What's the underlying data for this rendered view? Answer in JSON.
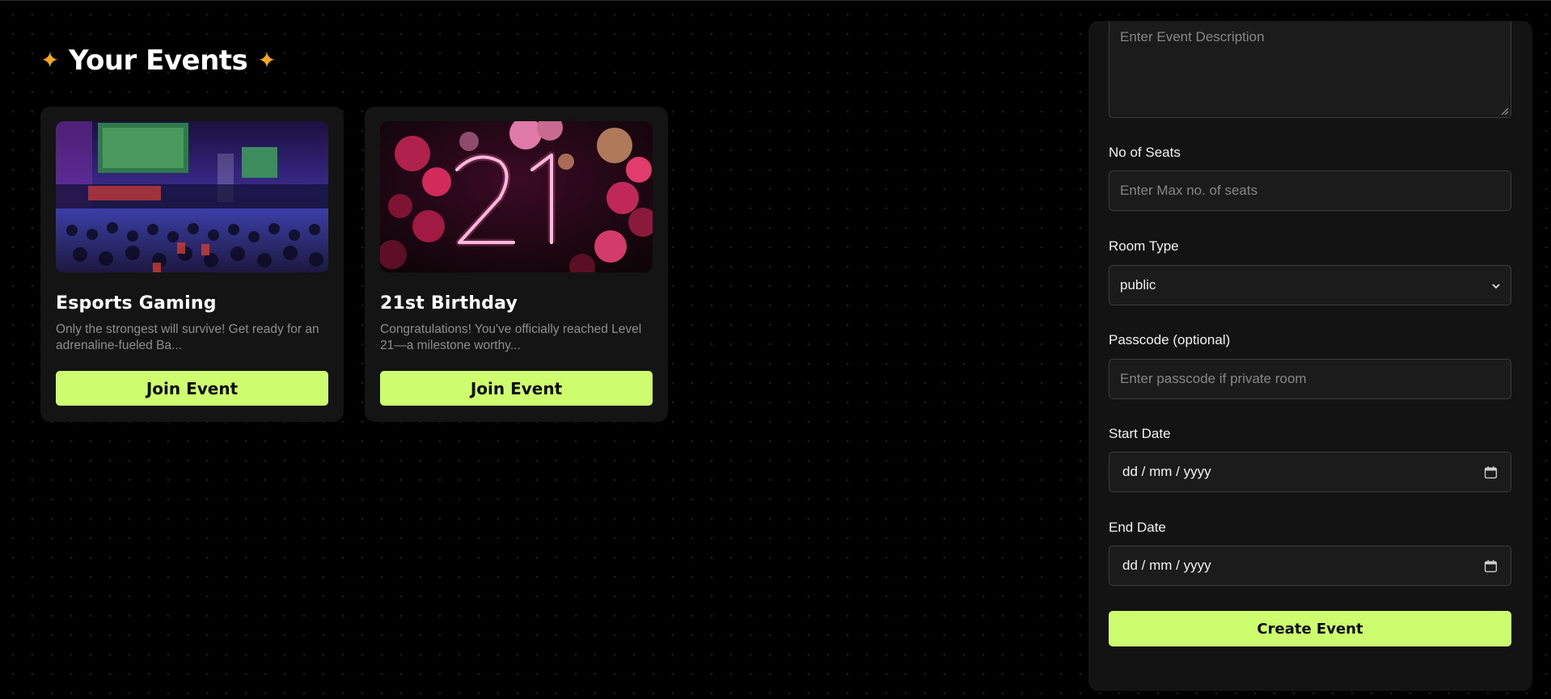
{
  "events": {
    "title": "Your Events",
    "sparkle_icon": "sparkle-icon",
    "accent_color": "#f5a623",
    "cards": [
      {
        "title": "Esports Gaming",
        "description": "Only the strongest will survive! Get ready for an adrenaline-fueled Ba...",
        "button_label": "Join Event",
        "image_subject": "esports arena with crowd and big screens"
      },
      {
        "title": "21st Birthday",
        "description": "Congratulations! You've officially reached Level 21—a milestone worthy...",
        "button_label": "Join Event",
        "image_subject": "neon number 21 with pink balloons"
      }
    ]
  },
  "form": {
    "description_placeholder": "Enter Event Description",
    "seats": {
      "label": "No of Seats",
      "placeholder": "Enter Max no. of seats"
    },
    "room_type": {
      "label": "Room Type",
      "value": "public"
    },
    "passcode": {
      "label": "Passcode (optional)",
      "placeholder": "Enter passcode if private room"
    },
    "start_date": {
      "label": "Start Date",
      "value": "dd / mm / yyyy"
    },
    "end_date": {
      "label": "End Date",
      "value": "dd / mm / yyyy"
    },
    "submit_label": "Create Event",
    "button_color": "#cdfc6e"
  }
}
